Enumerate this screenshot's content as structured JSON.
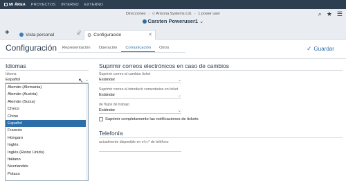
{
  "topnav": {
    "brand": "MI ÁREA",
    "links": [
      "PROYECTOS",
      "INTERNO",
      "EXTERNO"
    ]
  },
  "header": {
    "breadcrumb": [
      "Direcciones",
      "Arisona Systems Ltd.",
      "1 power user"
    ],
    "user_name": "Carsten Poweruser1",
    "icons": [
      "search-icon",
      "star-icon",
      "menu-icon"
    ]
  },
  "tabs": [
    {
      "label": "Vista personal",
      "icon": "globe-icon",
      "active": false
    },
    {
      "label": "Configuración",
      "icon": "gear-icon",
      "active": true
    }
  ],
  "page": {
    "title": "Configuración",
    "subtabs": [
      "Representación",
      "Operación",
      "Comunicación",
      "Otros"
    ],
    "active_subtab": "Comunicación",
    "save_label": "Guardar"
  },
  "idiomas": {
    "heading": "Idiomas",
    "label": "Idioma",
    "value": "Español",
    "options": [
      "Alemán (Alemania)",
      "Alemán (Austria)",
      "Alemán (Suiza)",
      "Checo",
      "Chino",
      "Español",
      "Francés",
      "Húngaro",
      "Inglés",
      "Inglés (Reino Unido)",
      "Italiano",
      "Neerlandés",
      "Polaco"
    ],
    "selected_index": 5
  },
  "email": {
    "heading": "Suprimir correos electrónicos en caso de cambios",
    "fields": [
      {
        "label": "Suprimir correo al cambiar ticket",
        "value": "Estándar"
      },
      {
        "label": "Suprimir correo al introducir comentarios en ticket",
        "value": "Estándar"
      },
      {
        "label": "de flujos de trabajo",
        "value": "Estándar"
      }
    ],
    "checkbox_label": "Suprimir completamente las notificaciones de tickets"
  },
  "telefonia": {
    "heading": "Telefonía",
    "label": "actualmente disponible en el n.º de teléfono",
    "value": ""
  },
  "colors": {
    "nav_bg": "#2d3e50",
    "accent": "#2d6ea8",
    "header_bg": "#e9edf1"
  }
}
